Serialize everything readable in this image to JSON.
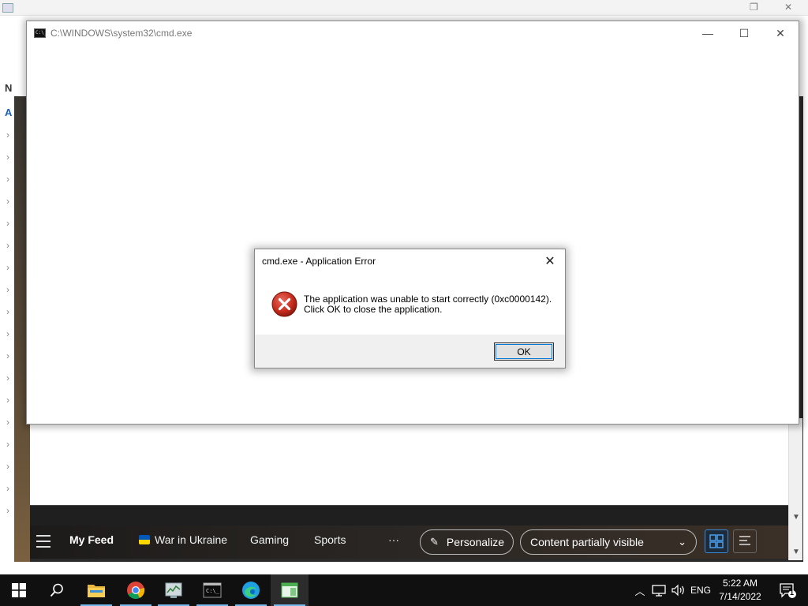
{
  "cmd_window": {
    "title": "C:\\WINDOWS\\system32\\cmd.exe",
    "icon_glyph": "C:\\_",
    "controls": {
      "minimize": "—",
      "maximize": "☐",
      "close": "✕"
    }
  },
  "dialog": {
    "title": "cmd.exe - Application Error",
    "close": "✕",
    "message_line1": "The application was unable to start correctly (0xc0000142).",
    "message_line2": "Click OK to close the application.",
    "ok_label": "OK",
    "icon": "error-icon",
    "icon_color": "#c42b1c"
  },
  "background": {
    "left_letters": [
      "N",
      "A"
    ]
  },
  "feed_bar": {
    "items": [
      {
        "label": "My Feed"
      },
      {
        "label": "War in Ukraine"
      },
      {
        "label": "Gaming"
      },
      {
        "label": "Sports"
      }
    ],
    "more": "···",
    "personalize": "Personalize",
    "content_dropdown": "Content partially visible"
  },
  "taskbar": {
    "language": "ENG",
    "time": "5:22 AM",
    "date": "7/14/2022",
    "notification_count": "1",
    "accent": "#76b9ed"
  }
}
